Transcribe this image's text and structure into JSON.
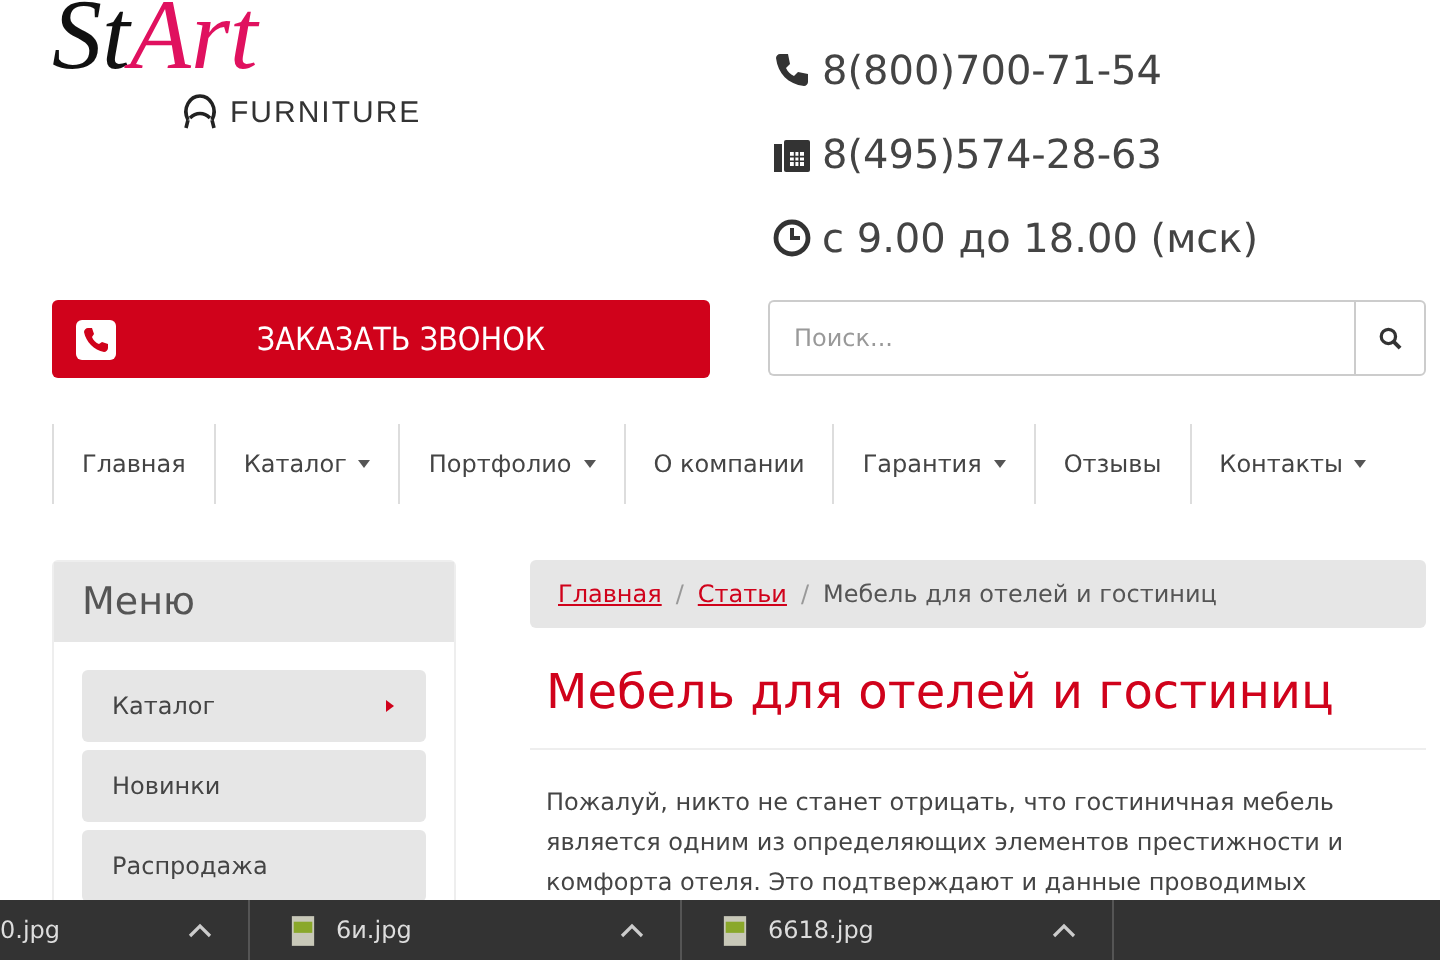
{
  "logo": {
    "part_1": "St",
    "part_2": "Art",
    "subtitle": "FURNITURE"
  },
  "contacts": [
    {
      "kind": "phone",
      "text": "8(800)700-71-54"
    },
    {
      "kind": "fax",
      "text": "8(495)574-28-63"
    },
    {
      "kind": "clock",
      "text": "с 9.00 до 18.00 (мск)"
    }
  ],
  "call_button": {
    "label": "ЗАКАЗАТЬ ЗВОНОК"
  },
  "search": {
    "placeholder": "Поиск..."
  },
  "nav": [
    {
      "label": "Главная",
      "dropdown": false
    },
    {
      "label": "Каталог",
      "dropdown": true
    },
    {
      "label": "Портфолио",
      "dropdown": true
    },
    {
      "label": "О компании",
      "dropdown": false
    },
    {
      "label": "Гарантия",
      "dropdown": true
    },
    {
      "label": "Отзывы",
      "dropdown": false
    },
    {
      "label": "Контакты",
      "dropdown": true
    }
  ],
  "sidebar": {
    "title": "Меню",
    "items": [
      {
        "label": "Каталог",
        "submenu": true
      },
      {
        "label": "Новинки",
        "submenu": false
      },
      {
        "label": "Распродажа",
        "submenu": false
      }
    ]
  },
  "breadcrumb": [
    {
      "label": "Главная",
      "link": true
    },
    {
      "label": "Статьи",
      "link": true
    },
    {
      "label": "Мебель для отелей и гостиниц",
      "link": false
    }
  ],
  "breadcrumb_separator": "/",
  "article": {
    "title": "Мебель для отелей и гостиниц",
    "paragraph": "Пожалуй, никто не станет отрицать, что гостиничная мебель является одним из определяющих элементов престижности и комфорта отеля. Это подтверждают и данные проводимых"
  },
  "downloads": [
    {
      "name": "0.jpg",
      "icon": false
    },
    {
      "name": "6и.jpg",
      "icon": true
    },
    {
      "name": "6618.jpg",
      "icon": true
    }
  ]
}
